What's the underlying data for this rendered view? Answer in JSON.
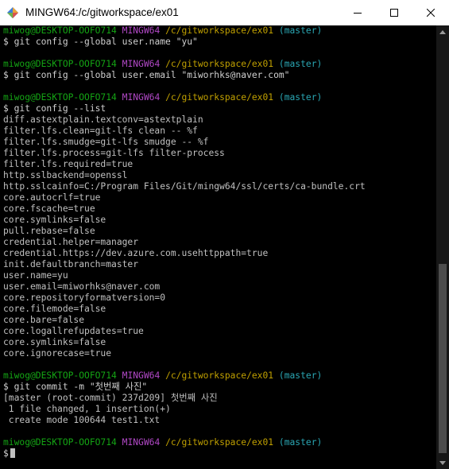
{
  "window": {
    "title": "MINGW64:/c/gitworkspace/ex01"
  },
  "prompt": {
    "user": "miwog@DESKTOP-OOFO714",
    "system": "MINGW64",
    "path": "/c/gitworkspace/ex01",
    "branch": "(master)",
    "symbol": "$"
  },
  "commands": {
    "c1": " git config --global user.name \"yu\"",
    "c2": " git config --global user.email \"miworhks@naver.com\"",
    "c3": " git config --list",
    "c4": " git commit -m \"첫번째 사진\""
  },
  "config_output": [
    "diff.astextplain.textconv=astextplain",
    "filter.lfs.clean=git-lfs clean -- %f",
    "filter.lfs.smudge=git-lfs smudge -- %f",
    "filter.lfs.process=git-lfs filter-process",
    "filter.lfs.required=true",
    "http.sslbackend=openssl",
    "http.sslcainfo=C:/Program Files/Git/mingw64/ssl/certs/ca-bundle.crt",
    "core.autocrlf=true",
    "core.fscache=true",
    "core.symlinks=false",
    "pull.rebase=false",
    "credential.helper=manager",
    "credential.https://dev.azure.com.usehttppath=true",
    "init.defaultbranch=master",
    "user.name=yu",
    "user.email=miworhks@naver.com",
    "core.repositoryformatversion=0",
    "core.filemode=false",
    "core.bare=false",
    "core.logallrefupdates=true",
    "core.symlinks=false",
    "core.ignorecase=true"
  ],
  "commit_output": [
    "[master (root-commit) 237d209] 첫번째 사진",
    " 1 file changed, 1 insertion(+)",
    " create mode 100644 test1.txt"
  ],
  "colors": {
    "user": "#14a514",
    "system": "#b148c6",
    "path": "#c0a000",
    "branch": "#2aa7b4",
    "text": "#c0c0c0",
    "background": "#000000"
  },
  "icons": {
    "app": "mingw-app-icon",
    "minimize": "minimize-icon",
    "maximize": "maximize-icon",
    "close": "close-icon"
  }
}
